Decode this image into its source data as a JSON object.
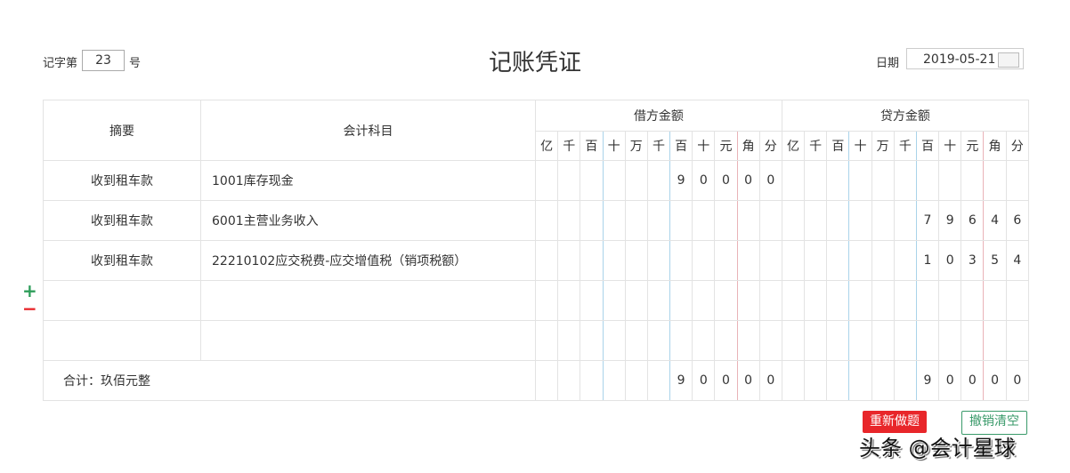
{
  "header": {
    "voucher_prefix": "记字第",
    "voucher_number": "23",
    "voucher_suffix": "号",
    "title": "记账凭证",
    "date_label": "日期",
    "date_value": "2019-05-21"
  },
  "table": {
    "col_summary": "摘要",
    "col_subject": "会计科目",
    "col_debit": "借方金额",
    "col_credit": "贷方金额",
    "units": [
      "亿",
      "千",
      "百",
      "十",
      "万",
      "千",
      "百",
      "十",
      "元",
      "角",
      "分"
    ],
    "rows": [
      {
        "summary": "收到租车款",
        "subject": "1001库存现金",
        "debit": [
          "",
          "",
          "",
          "",
          "",
          "",
          "9",
          "0",
          "0",
          "0",
          "0"
        ],
        "credit": [
          "",
          "",
          "",
          "",
          "",
          "",
          "",
          "",
          "",
          "",
          ""
        ]
      },
      {
        "summary": "收到租车款",
        "subject": "6001主营业务收入",
        "debit": [
          "",
          "",
          "",
          "",
          "",
          "",
          "",
          "",
          "",
          "",
          ""
        ],
        "credit": [
          "",
          "",
          "",
          "",
          "",
          "",
          "7",
          "9",
          "6",
          "4",
          "6"
        ]
      },
      {
        "summary": "收到租车款",
        "subject": "22210102应交税费-应交增值税（销项税额）",
        "debit": [
          "",
          "",
          "",
          "",
          "",
          "",
          "",
          "",
          "",
          "",
          ""
        ],
        "credit": [
          "",
          "",
          "",
          "",
          "",
          "",
          "1",
          "0",
          "3",
          "5",
          "4"
        ]
      },
      {
        "summary": "",
        "subject": "",
        "debit": [
          "",
          "",
          "",
          "",
          "",
          "",
          "",
          "",
          "",
          "",
          ""
        ],
        "credit": [
          "",
          "",
          "",
          "",
          "",
          "",
          "",
          "",
          "",
          "",
          ""
        ]
      },
      {
        "summary": "",
        "subject": "",
        "debit": [
          "",
          "",
          "",
          "",
          "",
          "",
          "",
          "",
          "",
          "",
          ""
        ],
        "credit": [
          "",
          "",
          "",
          "",
          "",
          "",
          "",
          "",
          "",
          "",
          ""
        ]
      }
    ],
    "total_label": "合计：玖佰元整",
    "total_debit": [
      "",
      "",
      "",
      "",
      "",
      "",
      "9",
      "0",
      "0",
      "0",
      "0"
    ],
    "total_credit": [
      "",
      "",
      "",
      "",
      "",
      "",
      "9",
      "0",
      "0",
      "0",
      "0"
    ]
  },
  "actions": {
    "add": "+",
    "remove": "−",
    "redo": "重新做题",
    "clear": "撤销清空"
  },
  "watermark": "头条 @会计星球",
  "colors": {
    "add": "#2e9d5a",
    "remove": "#e8262a",
    "redo": "#e8262a",
    "clear": "#3a9a6a"
  }
}
